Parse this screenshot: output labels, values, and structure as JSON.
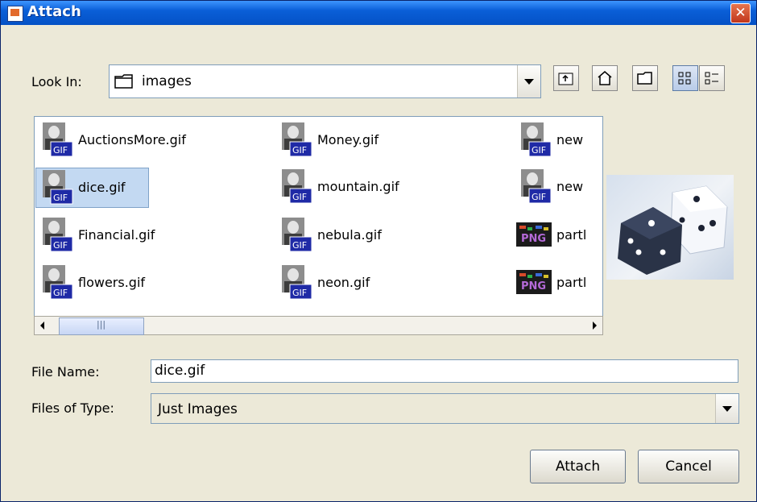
{
  "window": {
    "title": "Attach"
  },
  "look_in": {
    "label": "Look In:",
    "value": "images"
  },
  "toolbar": {
    "up_icon": "up-folder-icon",
    "home_icon": "home-icon",
    "new_folder_icon": "new-folder-icon",
    "list_icon": "list-view-icon",
    "details_icon": "details-view-icon"
  },
  "files": [
    {
      "name": "AuctionsMore.gif",
      "type": "gif"
    },
    {
      "name": "dice.gif",
      "type": "gif",
      "selected": true
    },
    {
      "name": "Financial.gif",
      "type": "gif"
    },
    {
      "name": "flowers.gif",
      "type": "gif"
    },
    {
      "name": "Money.gif",
      "type": "gif"
    },
    {
      "name": "mountain.gif",
      "type": "gif"
    },
    {
      "name": "nebula.gif",
      "type": "gif"
    },
    {
      "name": "neon.gif",
      "type": "gif"
    },
    {
      "name": "new",
      "type": "gif"
    },
    {
      "name": "new",
      "type": "gif"
    },
    {
      "name": "partl",
      "type": "png"
    },
    {
      "name": "partl",
      "type": "png"
    }
  ],
  "file_name": {
    "label": "File Name:",
    "value": "dice.gif"
  },
  "files_of_type": {
    "label": "Files of Type:",
    "value": "Just Images"
  },
  "buttons": {
    "attach": "Attach",
    "cancel": "Cancel"
  },
  "icon_badges": {
    "gif": "GIF",
    "png": "PNG"
  },
  "colors": {
    "title_bar": "#0a5fd8",
    "selection": "#c3d9f2",
    "dialog_bg": "#ece9d8"
  }
}
